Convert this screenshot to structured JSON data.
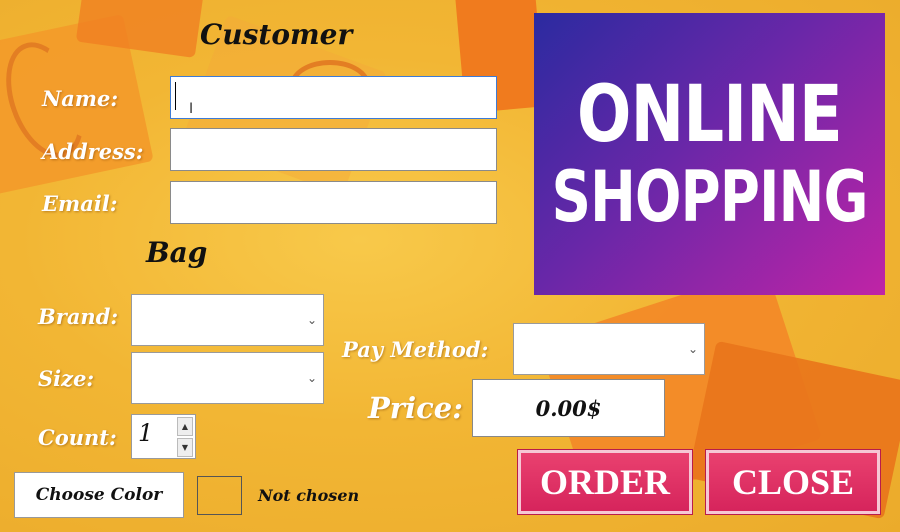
{
  "customer": {
    "heading": "Customer",
    "name_label": "Name:",
    "name_value": "",
    "address_label": "Address:",
    "address_value": "",
    "email_label": "Email:",
    "email_value": ""
  },
  "bag": {
    "heading": "Bag",
    "brand_label": "Brand:",
    "brand_value": "",
    "size_label": "Size:",
    "size_value": "",
    "count_label": "Count:",
    "count_value": "1"
  },
  "payment": {
    "method_label": "Pay Method:",
    "method_value": "",
    "price_label": "Price:",
    "price_value": "0.00$"
  },
  "banner": {
    "line1": "ONLINE",
    "line2": "SHOPPING"
  },
  "color": {
    "button_label": "Choose Color",
    "status": "Not chosen"
  },
  "actions": {
    "order_label": "ORDER",
    "close_label": "CLOSE"
  },
  "colors": {
    "button_accent": "#d6245c",
    "banner_start": "#2b2aa0",
    "banner_end": "#c024a6",
    "background": "#f2b634"
  },
  "icons": {
    "combo_arrow": "chevron-down-icon",
    "spin_up": "spin-up-icon",
    "spin_down": "spin-down-icon"
  }
}
